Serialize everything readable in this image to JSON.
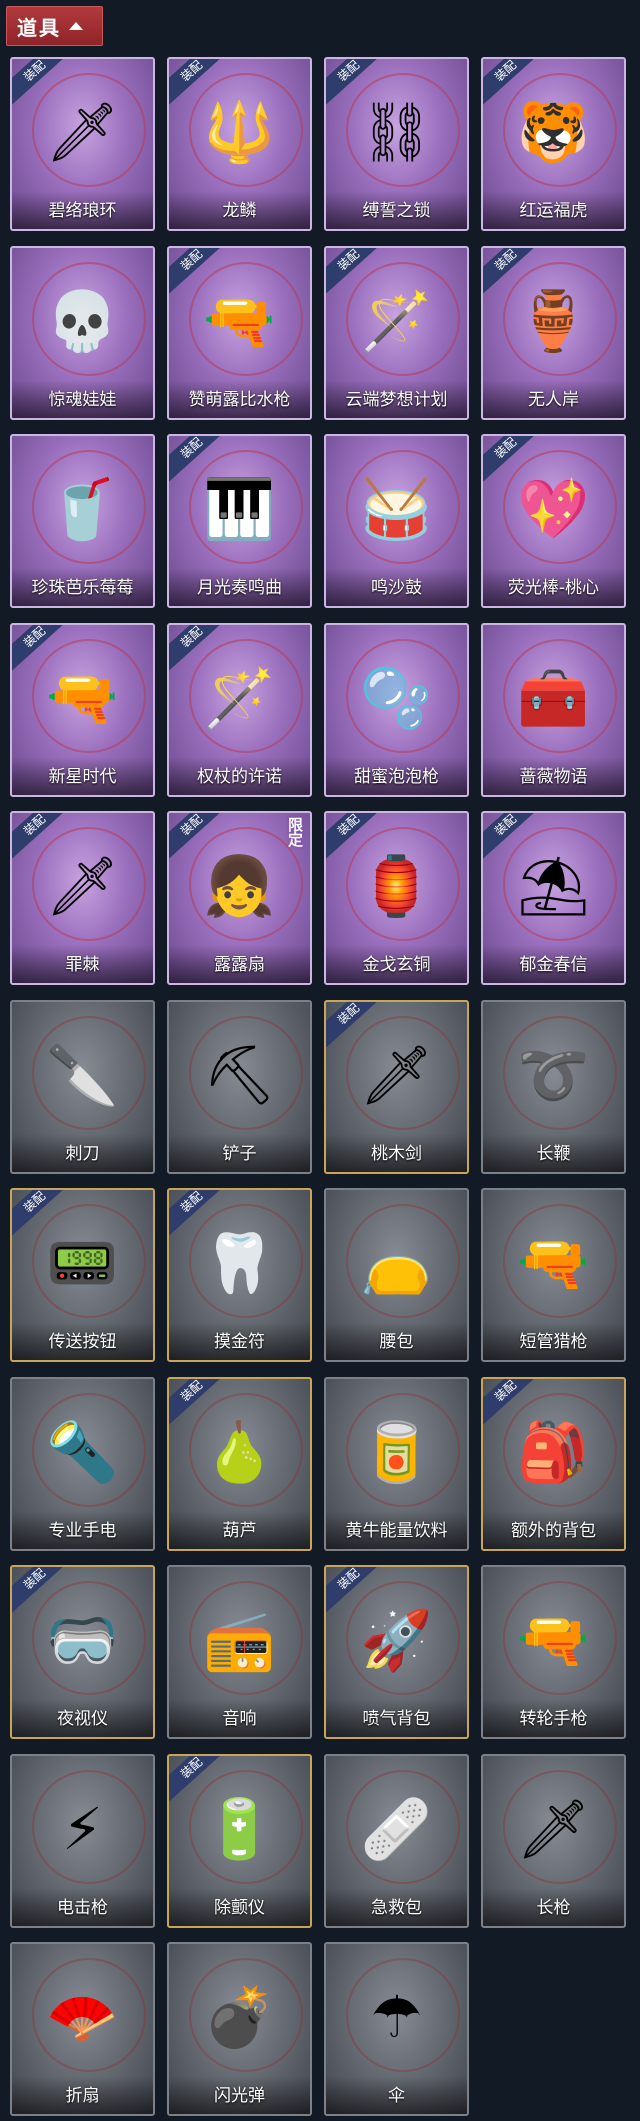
{
  "header": {
    "title": "道具"
  },
  "labels": {
    "equipped": "装配",
    "limited": "限定"
  },
  "items": [
    {
      "name": "碧络琅环",
      "rarity": "purple",
      "equipped": true,
      "icon": "🗡"
    },
    {
      "name": "龙鳞",
      "rarity": "purple",
      "equipped": true,
      "icon": "🔱"
    },
    {
      "name": "缚誓之锁",
      "rarity": "purple",
      "equipped": true,
      "icon": "⛓"
    },
    {
      "name": "红运福虎",
      "rarity": "purple",
      "equipped": true,
      "icon": "🐯"
    },
    {
      "name": "惊魂娃娃",
      "rarity": "purple",
      "equipped": false,
      "icon": "💀"
    },
    {
      "name": "赞萌露比水枪",
      "rarity": "purple",
      "equipped": true,
      "icon": "🔫"
    },
    {
      "name": "云端梦想计划",
      "rarity": "purple",
      "equipped": true,
      "icon": "🪄"
    },
    {
      "name": "无人岸",
      "rarity": "purple",
      "equipped": true,
      "icon": "🏺"
    },
    {
      "name": "珍珠芭乐莓莓",
      "rarity": "purple",
      "equipped": false,
      "icon": "🥤"
    },
    {
      "name": "月光奏鸣曲",
      "rarity": "purple",
      "equipped": true,
      "icon": "🎹"
    },
    {
      "name": "鸣沙鼓",
      "rarity": "purple",
      "equipped": false,
      "icon": "🥁"
    },
    {
      "name": "荧光棒-桃心",
      "rarity": "purple",
      "equipped": true,
      "icon": "💖"
    },
    {
      "name": "新星时代",
      "rarity": "purple",
      "equipped": true,
      "icon": "🔫"
    },
    {
      "name": "权杖的许诺",
      "rarity": "purple",
      "equipped": true,
      "icon": "🪄"
    },
    {
      "name": "甜蜜泡泡枪",
      "rarity": "purple",
      "equipped": false,
      "icon": "🫧"
    },
    {
      "name": "蔷薇物语",
      "rarity": "purple",
      "equipped": false,
      "icon": "🧰"
    },
    {
      "name": "罪棘",
      "rarity": "purple",
      "equipped": true,
      "icon": "🗡"
    },
    {
      "name": "露露扇",
      "rarity": "purple",
      "equipped": true,
      "limited": true,
      "icon": "👧"
    },
    {
      "name": "金戈玄铜",
      "rarity": "purple",
      "equipped": true,
      "icon": "🏮"
    },
    {
      "name": "郁金春信",
      "rarity": "purple",
      "equipped": true,
      "icon": "⛱"
    },
    {
      "name": "刺刀",
      "rarity": "grey",
      "equipped": false,
      "icon": "🔪"
    },
    {
      "name": "铲子",
      "rarity": "grey",
      "equipped": false,
      "icon": "⛏"
    },
    {
      "name": "桃木剑",
      "rarity": "grey",
      "equipped": true,
      "icon": "🗡"
    },
    {
      "name": "长鞭",
      "rarity": "grey",
      "equipped": false,
      "icon": "➰"
    },
    {
      "name": "传送按钮",
      "rarity": "grey",
      "equipped": true,
      "icon": "📟"
    },
    {
      "name": "摸金符",
      "rarity": "grey",
      "equipped": true,
      "icon": "🦷"
    },
    {
      "name": "腰包",
      "rarity": "grey",
      "equipped": false,
      "icon": "👝"
    },
    {
      "name": "短管猎枪",
      "rarity": "grey",
      "equipped": false,
      "icon": "🔫"
    },
    {
      "name": "专业手电",
      "rarity": "grey",
      "equipped": false,
      "icon": "🔦"
    },
    {
      "name": "葫芦",
      "rarity": "grey",
      "equipped": true,
      "icon": "🍐"
    },
    {
      "name": "黄牛能量饮料",
      "rarity": "grey",
      "equipped": false,
      "icon": "🥫"
    },
    {
      "name": "额外的背包",
      "rarity": "grey",
      "equipped": true,
      "icon": "🎒"
    },
    {
      "name": "夜视仪",
      "rarity": "grey",
      "equipped": true,
      "icon": "🥽"
    },
    {
      "name": "音响",
      "rarity": "grey",
      "equipped": false,
      "icon": "📻"
    },
    {
      "name": "喷气背包",
      "rarity": "grey",
      "equipped": true,
      "icon": "🚀"
    },
    {
      "name": "转轮手枪",
      "rarity": "grey",
      "equipped": false,
      "icon": "🔫"
    },
    {
      "name": "电击枪",
      "rarity": "grey",
      "equipped": false,
      "icon": "⚡"
    },
    {
      "name": "除颤仪",
      "rarity": "grey",
      "equipped": true,
      "icon": "🔋"
    },
    {
      "name": "急救包",
      "rarity": "grey",
      "equipped": false,
      "icon": "🩹"
    },
    {
      "name": "长枪",
      "rarity": "grey",
      "equipped": false,
      "icon": "🗡"
    },
    {
      "name": "折扇",
      "rarity": "grey",
      "equipped": false,
      "icon": "🪭"
    },
    {
      "name": "闪光弹",
      "rarity": "grey",
      "equipped": false,
      "icon": "💣"
    },
    {
      "name": "伞",
      "rarity": "grey",
      "equipped": false,
      "icon": "☂"
    }
  ]
}
